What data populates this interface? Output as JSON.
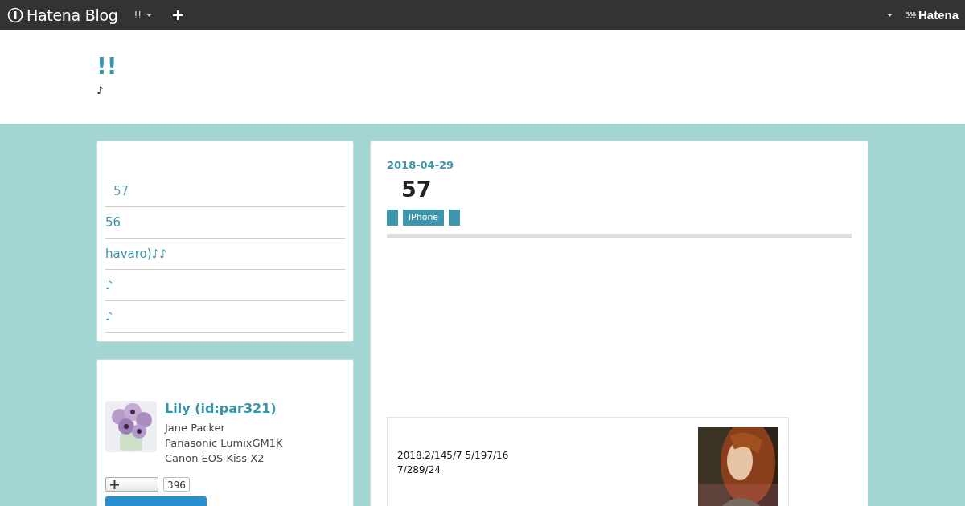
{
  "topbar": {
    "brand": "Hatena Blog",
    "blog_menu": "!!",
    "right_brand": "Hatena"
  },
  "header": {
    "title": "!!",
    "description": "♪"
  },
  "recent_entries": [
    "57",
    "56",
    "havaro)♪♪",
    "♪",
    "♪"
  ],
  "profile": {
    "name": "Lily (id:par321)",
    "lines": [
      "Jane Packer",
      "Panasonic LumixGM1K",
      "Canon EOS Kiss X2"
    ],
    "follow_count": "396"
  },
  "entry": {
    "date": "2018-04-29",
    "title": "57",
    "tags": [
      {
        "kind": "blank"
      },
      {
        "kind": "text",
        "label": "iPhone"
      },
      {
        "kind": "blank"
      }
    ],
    "embed": {
      "lines": [
        "2018.2/145/7 5/197/16",
        "7/289/24"
      ],
      "cover": {
        "kind": "picture"
      }
    }
  }
}
